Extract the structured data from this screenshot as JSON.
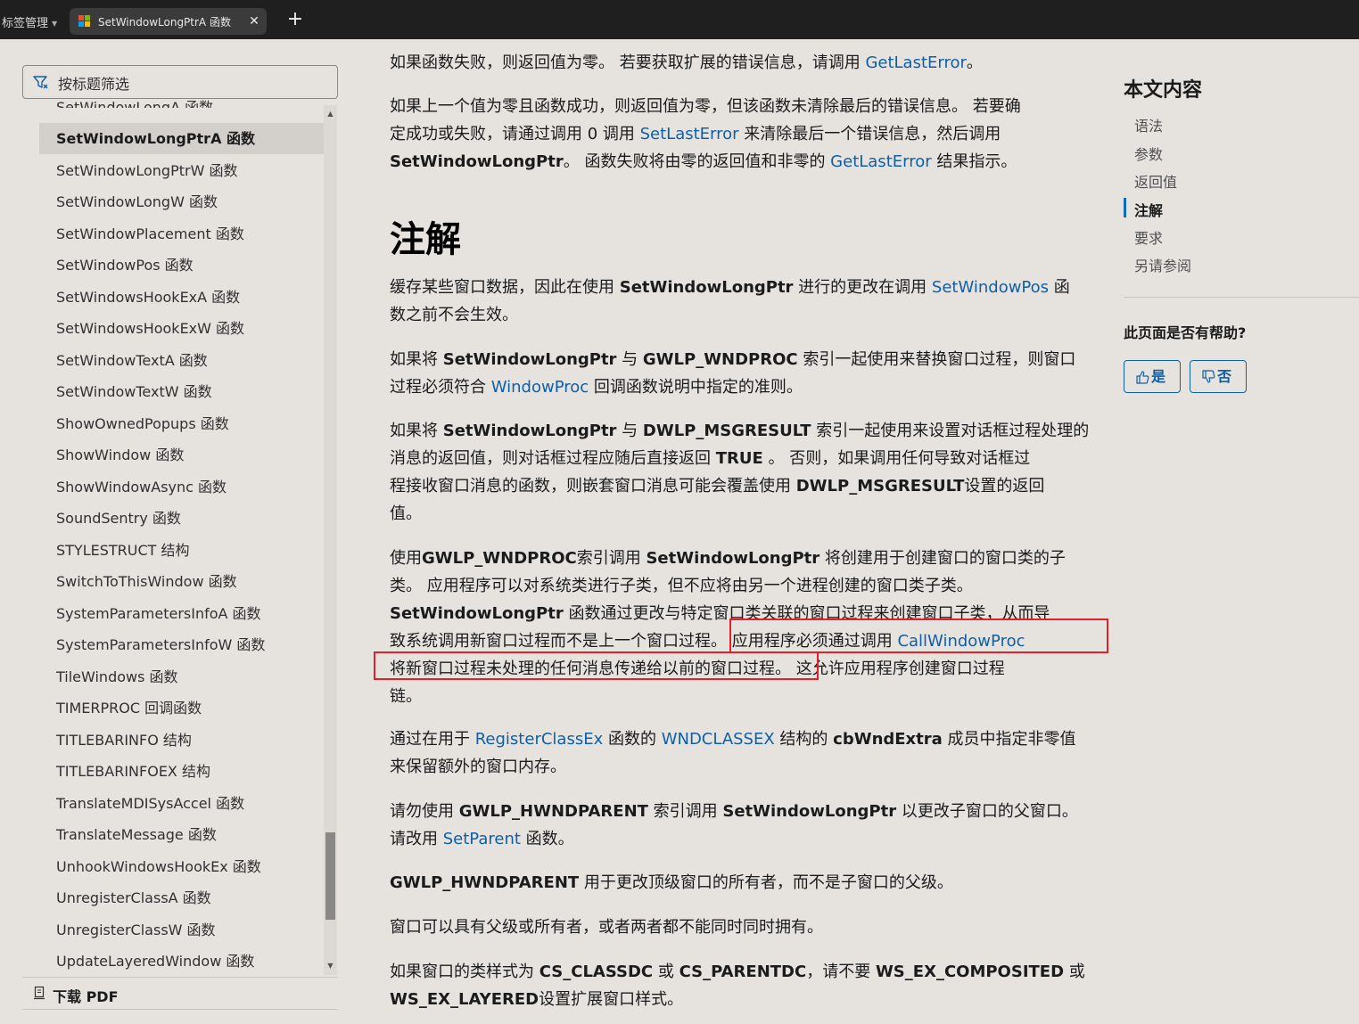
{
  "browser": {
    "tab_group_label": "标签管理",
    "active_tab_title": "SetWindowLongPtrA 函数",
    "active_tab_paren": "(",
    "close_glyph": "✕",
    "new_tab_glyph": "+"
  },
  "sidebar": {
    "filter_placeholder": "按标题筛选",
    "partial_item": "SetWindowLongA 函数",
    "items": [
      {
        "label": "SetWindowLongPtrA 函数",
        "active": true
      },
      {
        "label": "SetWindowLongPtrW 函数"
      },
      {
        "label": "SetWindowLongW 函数"
      },
      {
        "label": "SetWindowPlacement 函数"
      },
      {
        "label": "SetWindowPos 函数"
      },
      {
        "label": "SetWindowsHookExA 函数"
      },
      {
        "label": "SetWindowsHookExW 函数"
      },
      {
        "label": "SetWindowTextA 函数"
      },
      {
        "label": "SetWindowTextW 函数"
      },
      {
        "label": "ShowOwnedPopups 函数"
      },
      {
        "label": "ShowWindow 函数"
      },
      {
        "label": "ShowWindowAsync 函数"
      },
      {
        "label": "SoundSentry 函数"
      },
      {
        "label": "STYLESTRUCT 结构"
      },
      {
        "label": "SwitchToThisWindow 函数"
      },
      {
        "label": "SystemParametersInfoA 函数"
      },
      {
        "label": "SystemParametersInfoW 函数"
      },
      {
        "label": "TileWindows 函数"
      },
      {
        "label": "TIMERPROC 回调函数"
      },
      {
        "label": "TITLEBARINFO 结构"
      },
      {
        "label": "TITLEBARINFOEX 结构"
      },
      {
        "label": "TranslateMDISysAccel 函数"
      },
      {
        "label": "TranslateMessage 函数"
      },
      {
        "label": "UnhookWindowsHookEx 函数"
      },
      {
        "label": "UnregisterClassA 函数"
      },
      {
        "label": "UnregisterClassW 函数"
      },
      {
        "label": "UpdateLayeredWindow 函数"
      }
    ],
    "download_label": "下载 PDF"
  },
  "article": {
    "p1": {
      "a": "如果函数失败，则返回值为零。 若要获取扩展的错误信息，请调用 ",
      "link": "GetLastError",
      "b": "。"
    },
    "p2": {
      "l1": "如果上一个值为零且函数成功，则返回值为零，但该函数未清除最后的错误信息。 若要确",
      "l2a": "定成功或失败，请通过调用 0 调用 ",
      "l2link": "SetLastError",
      "l2b": " 来清除最后一个错误信息，然后调用",
      "l3bold": "SetWindowLongPtr",
      "l3a": "。 函数失败将由零的返回值和非零的 ",
      "l3link": "GetLastError",
      "l3b": " 结果指示。"
    },
    "heading": "注解",
    "p3": {
      "l1a": "缓存某些窗口数据，因此在使用 ",
      "l1bold": "SetWindowLongPtr",
      "l1b": " 进行的更改在调用 ",
      "l1link": "SetWindowPos",
      "l1c": " 函",
      "l2": "数之前不会生效。"
    },
    "p4": {
      "l1a": "如果将 ",
      "l1bold1": "SetWindowLongPtr",
      "l1b": " 与 ",
      "l1bold2": "GWLP_WNDPROC",
      "l1c": " 索引一起使用来替换窗口过程，则窗口",
      "l2a": "过程必须符合 ",
      "l2link": "WindowProc",
      "l2b": " 回调函数说明中指定的准则。"
    },
    "p5": {
      "l1a": "如果将 ",
      "l1bold1": "SetWindowLongPtr",
      "l1b": " 与 ",
      "l1bold2": "DWLP_MSGRESULT",
      "l1c": " 索引一起使用来设置对话框过程处理的",
      "l2a": "消息的返回值，则对话框过程应随后直接返回 ",
      "l2bold": "TRUE",
      "l2b": " 。 否则，如果调用任何导致对话框过",
      "l3a": "程接收窗口消息的函数，则嵌套窗口消息可能会覆盖使用 ",
      "l3bold": "DWLP_MSGRESULT",
      "l3b": "设置的返回",
      "l4": "值。"
    },
    "p6": {
      "l1a": "使用",
      "l1bold1": "GWLP_WNDPROC",
      "l1b": "索引调用 ",
      "l1bold2": "SetWindowLongPtr",
      "l1c": " 将创建用于创建窗口的窗口类的子",
      "l2": "类。 应用程序可以对系统类进行子类，但不应将由另一个进程创建的窗口类子类。",
      "l3bold": "SetWindowLongPtr",
      "l3a": " 函数通过更改与特定窗口类关联的窗口过程来创建窗口子类，从而导",
      "l4a": "致系统调用新窗口过程而不是上一个窗口过程。 应用程序必须通过调用 ",
      "l4link": "CallWindowProc",
      "l5": "将新窗口过程未处理的任何消息传递给以前的窗口过程。 这允许应用程序创建窗口过程",
      "l6": "链。"
    },
    "p7": {
      "l1a": "通过在用于 ",
      "l1link1": "RegisterClassEx",
      "l1b": " 函数的 ",
      "l1link2": "WNDCLASSEX",
      "l1c": " 结构的 ",
      "l1bold": "cbWndExtra",
      "l1d": " 成员中指定非零值",
      "l2": "来保留额外的窗口内存。"
    },
    "p8": {
      "l1a": "请勿使用 ",
      "l1bold1": "GWLP_HWNDPARENT",
      "l1b": " 索引调用 ",
      "l1bold2": "SetWindowLongPtr",
      "l1c": " 以更改子窗口的父窗口。",
      "l2a": "请改用 ",
      "l2link": "SetParent",
      "l2b": " 函数。"
    },
    "p9": {
      "bold": "GWLP_HWNDPARENT",
      "a": " 用于更改顶级窗口的所有者，而不是子窗口的父级。"
    },
    "p10": "窗口可以具有父级或所有者，或者两者都不能同时同时拥有。",
    "p11": {
      "l1a": "如果窗口的类样式为 ",
      "l1bold1": "CS_CLASSDC",
      "l1b": " 或 ",
      "l1bold2": "CS_PARENTDC",
      "l1c": "，请不要 ",
      "l1bold3": "WS_EX_COMPOSITED",
      "l1d": " 或",
      "l2bold": "WS_EX_LAYERED",
      "l2a": "设置扩展窗口样式。"
    }
  },
  "toc_rail": {
    "title": "本文内容",
    "items": [
      "语法",
      "参数",
      "返回值",
      "注解",
      "要求",
      "另请参阅"
    ],
    "active_index": 3,
    "feedback_question": "此页面是否有帮助?",
    "yes_label": "是",
    "no_label": "否"
  },
  "colors": {
    "link": "#0f5fa8",
    "highlight_box": "#e0202a",
    "page_background": "#e6e3df"
  }
}
